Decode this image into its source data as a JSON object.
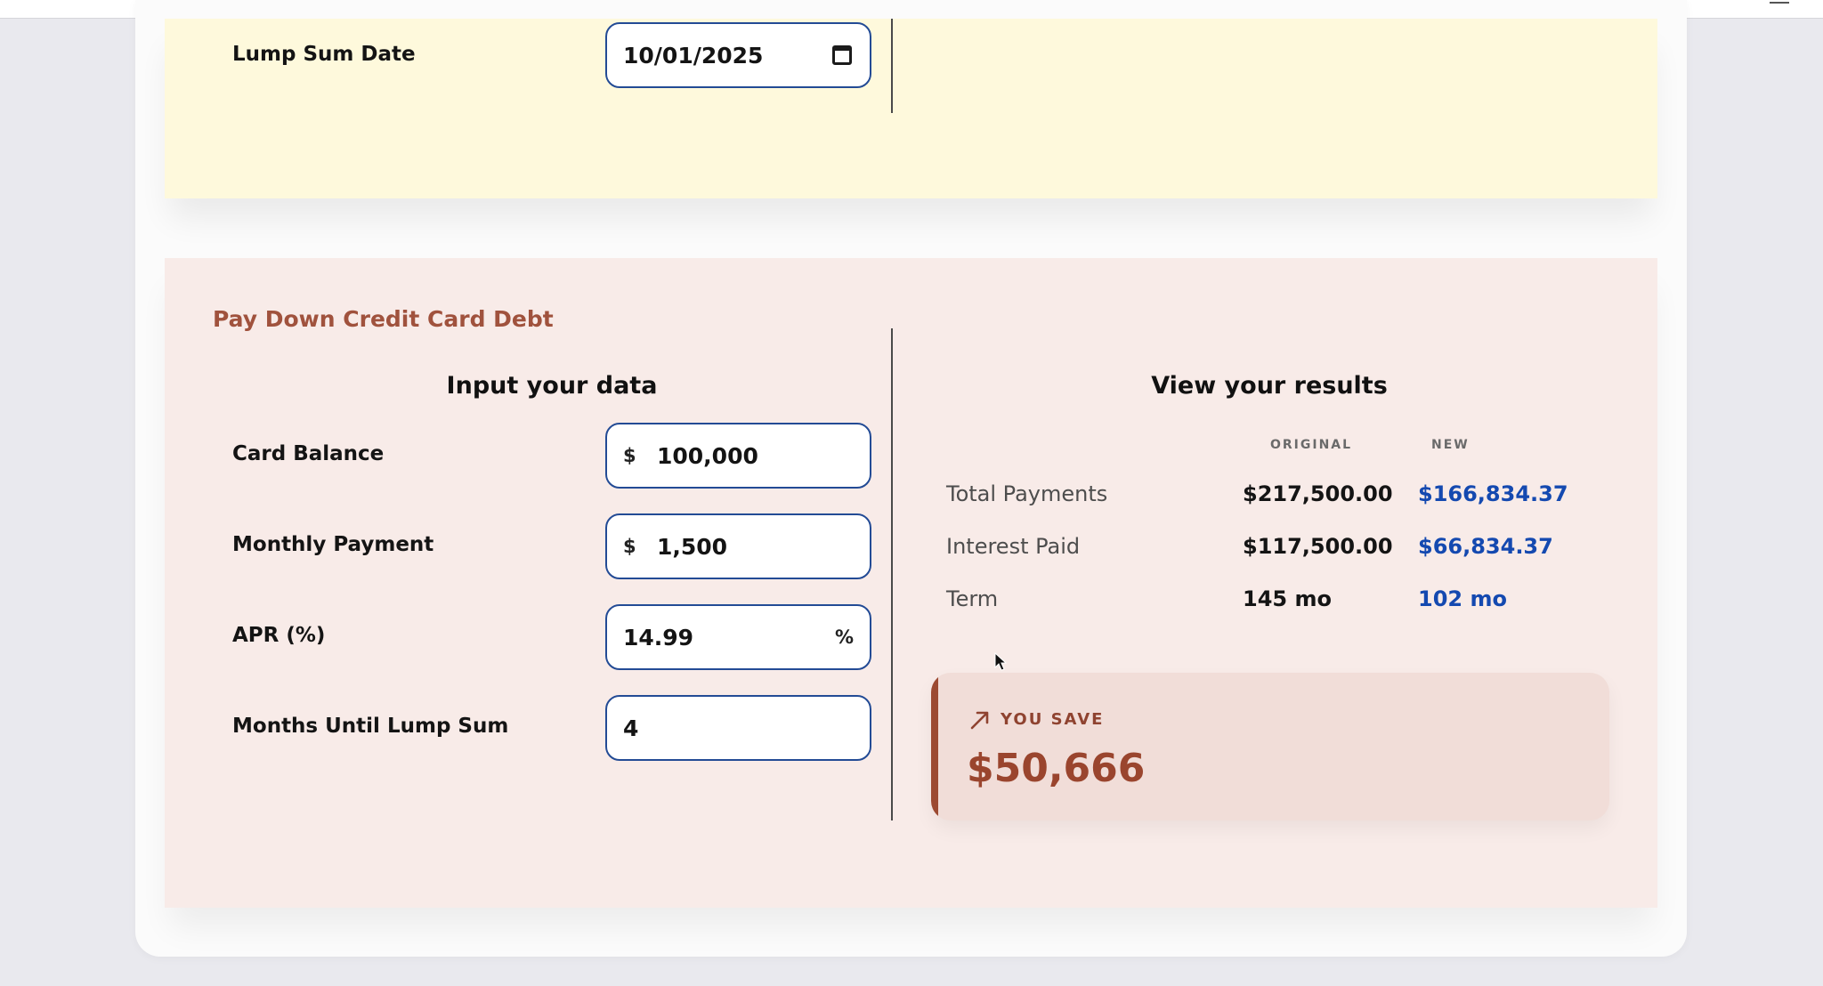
{
  "colors": {
    "accent_brown": "#a0523d",
    "new_value_blue": "#1449b0",
    "input_border": "#234b95",
    "yellow_bg": "#fef9dc",
    "pink_bg": "#f8ebe8",
    "savings_bg": "#f1ddd8"
  },
  "lump_sum_section": {
    "date_label": "Lump Sum Date",
    "date_value": "10/01/2025"
  },
  "credit_card_section": {
    "title": "Pay Down Credit Card Debt",
    "input_heading": "Input your data",
    "results_heading": "View your results",
    "fields": {
      "card_balance": {
        "label": "Card Balance",
        "prefix": "$",
        "value": "100,000"
      },
      "monthly_payment": {
        "label": "Monthly Payment",
        "prefix": "$",
        "value": "1,500"
      },
      "apr": {
        "label": "APR (%)",
        "value": "14.99",
        "suffix": "%"
      },
      "months_until_lump_sum": {
        "label": "Months Until Lump Sum",
        "value": "4"
      }
    },
    "results": {
      "col_original": "ORIGINAL",
      "col_new": "NEW",
      "rows": [
        {
          "label": "Total Payments",
          "original": "$217,500.00",
          "new": "$166,834.37"
        },
        {
          "label": "Interest Paid",
          "original": "$117,500.00",
          "new": "$66,834.37"
        },
        {
          "label": "Term",
          "original": "145 mo",
          "new": "102 mo"
        }
      ]
    },
    "savings": {
      "icon": "trending-up-icon",
      "label": "YOU SAVE",
      "value": "$50,666"
    }
  }
}
